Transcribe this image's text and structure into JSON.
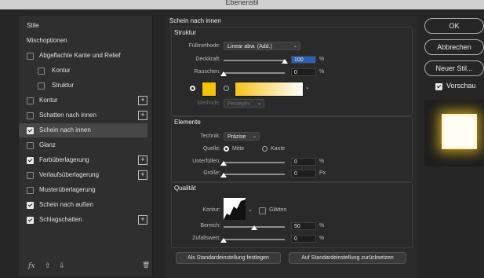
{
  "window": {
    "title": "Ebenenstil"
  },
  "left_panel": {
    "items": [
      {
        "label": "Stile",
        "checkbox": false,
        "checked": false,
        "plus": false,
        "indent": "top",
        "selected": false
      },
      {
        "label": "Mischoptionen",
        "checkbox": false,
        "checked": false,
        "plus": false,
        "indent": "top",
        "selected": false
      },
      {
        "label": "Abgeflachte Kante und Relief",
        "checkbox": true,
        "checked": false,
        "plus": false,
        "indent": "main",
        "selected": false
      },
      {
        "label": "Kontur",
        "checkbox": true,
        "checked": false,
        "plus": false,
        "indent": "sub",
        "selected": false
      },
      {
        "label": "Struktur",
        "checkbox": true,
        "checked": false,
        "plus": false,
        "indent": "sub",
        "selected": false
      },
      {
        "label": "Kontur",
        "checkbox": true,
        "checked": false,
        "plus": true,
        "indent": "main",
        "selected": false
      },
      {
        "label": "Schatten nach innen",
        "checkbox": true,
        "checked": false,
        "plus": true,
        "indent": "main",
        "selected": false
      },
      {
        "label": "Schein nach innen",
        "checkbox": true,
        "checked": true,
        "plus": false,
        "indent": "main",
        "selected": true
      },
      {
        "label": "Glanz",
        "checkbox": true,
        "checked": false,
        "plus": false,
        "indent": "main",
        "selected": false
      },
      {
        "label": "Farbüberlagerung",
        "checkbox": true,
        "checked": true,
        "plus": true,
        "indent": "main",
        "selected": false
      },
      {
        "label": "Verlaufsüberlagerung",
        "checkbox": true,
        "checked": false,
        "plus": true,
        "indent": "main",
        "selected": false
      },
      {
        "label": "Musterüberlagerung",
        "checkbox": true,
        "checked": false,
        "plus": false,
        "indent": "main",
        "selected": false
      },
      {
        "label": "Schein nach außen",
        "checkbox": true,
        "checked": true,
        "plus": false,
        "indent": "main",
        "selected": false
      },
      {
        "label": "Schlagschatten",
        "checkbox": true,
        "checked": true,
        "plus": true,
        "indent": "main",
        "selected": false
      }
    ],
    "fx_label": "fx",
    "up_arrow": "⇧",
    "down_arrow": "⇩",
    "trash_icon": "🗑"
  },
  "main": {
    "section_title": "Schein nach innen",
    "struktur": {
      "title": "Struktur",
      "fuellmethode_label": "Füllmethode:",
      "fuellmethode_value": "Linear abw. (Add.)",
      "deckkraft_label": "Deckkraft:",
      "deckkraft_value": "100",
      "deckkraft_level": 1.0,
      "rauschen_label": "Rauschen:",
      "rauschen_value": "0",
      "rauschen_level": 0,
      "unit_percent": "%",
      "color": "#f3c20a",
      "gradient_start": "#f6c21b",
      "gradient_end": "#ffffff",
      "methode_label": "Methode:",
      "methode_value": "Perzeptiv"
    },
    "elemente": {
      "title": "Elemente",
      "technik_label": "Technik:",
      "technik_value": "Präzise",
      "quelle_label": "Quelle:",
      "quelle_mitte": "Mitte",
      "quelle_kante": "Kante",
      "unterfuellen_label": "Unterfüllen:",
      "unterfuellen_value": "0",
      "unterfuellen_level": 0,
      "groesse_label": "Größe:",
      "groesse_value": "0",
      "groesse_level": 0,
      "unit_percent": "%",
      "unit_px": "Px"
    },
    "qualitaet": {
      "title": "Qualität",
      "kontur_label": "Kontur:",
      "glaetten_label": "Glätten",
      "bereich_label": "Bereich:",
      "bereich_value": "50",
      "bereich_level": 0.5,
      "zufall_label": "Zufallswert:",
      "zufall_value": "0",
      "zufall_level": 0,
      "unit_percent": "%"
    },
    "buttons": {
      "set_default": "Als Standardeinstellung festlegen",
      "reset_default": "Auf Standardeinstellung zurücksetzen"
    }
  },
  "right": {
    "ok": "OK",
    "cancel": "Abbrechen",
    "new_style": "Neuer Stil...",
    "preview_label": "Vorschau",
    "preview_checked": true
  }
}
